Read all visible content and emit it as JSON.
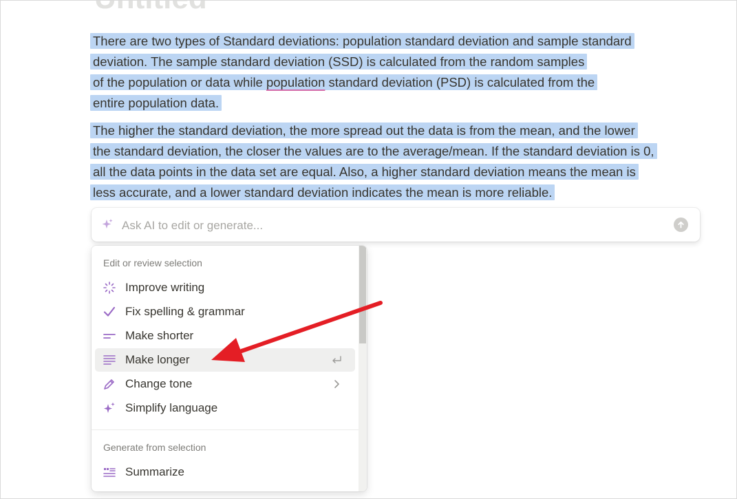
{
  "page": {
    "title": "Untitled"
  },
  "document": {
    "paragraph1": [
      "There are two types of Standard deviations: population standard deviation and sample standard",
      "deviation. The sample standard deviation (SSD) is calculated from the random samples",
      "of the population or data while ",
      "population",
      " standard deviation (PSD) is calculated from the",
      "entire population data."
    ],
    "paragraph2": [
      "The higher the standard deviation, the more spread out the data is from the mean, and the lower",
      "the standard deviation, the closer the values are to the average/mean. If the standard deviation is 0,",
      "all the data points in the data set are equal. Also, a higher standard deviation means the mean is",
      "less accurate, and a lower standard deviation indicates the mean is more reliable."
    ]
  },
  "ai_prompt": {
    "placeholder": "Ask AI to edit or generate...",
    "value": "",
    "icon": "sparkle-icon",
    "submit_icon": "arrow-up-icon"
  },
  "menu": {
    "section_edit": "Edit or review selection",
    "items_edit": [
      {
        "label": "Improve writing",
        "icon": "magic-wand-icon"
      },
      {
        "label": "Fix spelling & grammar",
        "icon": "checkmark-icon"
      },
      {
        "label": "Make shorter",
        "icon": "short-lines-icon"
      },
      {
        "label": "Make longer",
        "icon": "long-lines-icon",
        "active": true,
        "trailing": "enter-icon"
      },
      {
        "label": "Change tone",
        "icon": "pen-icon",
        "trailing": "chevron-right-icon"
      },
      {
        "label": "Simplify language",
        "icon": "sparkle-icon"
      }
    ],
    "section_generate": "Generate from selection",
    "items_generate": [
      {
        "label": "Summarize",
        "icon": "quote-lines-icon"
      }
    ]
  },
  "colors": {
    "selection": "#bcd5f3",
    "accent_purple": "#9b6bc6",
    "annotation_arrow": "#e41e25",
    "text": "#37352f",
    "muted": "#7d7c78"
  }
}
